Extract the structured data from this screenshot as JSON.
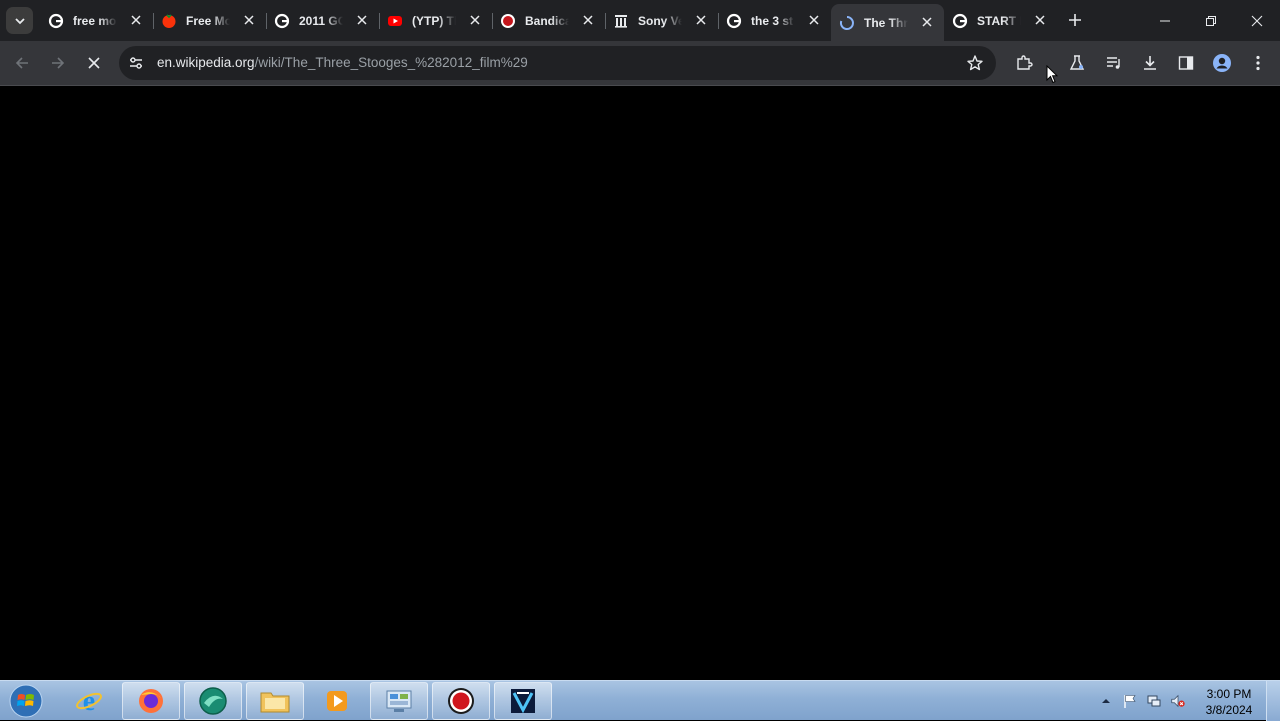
{
  "tabs": [
    {
      "title": "free mo",
      "icon": "google-icon"
    },
    {
      "title": "Free Mo",
      "icon": "tomato-icon"
    },
    {
      "title": "2011 GC",
      "icon": "google-icon"
    },
    {
      "title": "(YTP) Th",
      "icon": "youtube-icon"
    },
    {
      "title": "Bandica",
      "icon": "bandicam-icon"
    },
    {
      "title": "Sony Ve",
      "icon": "wikipedia-icon"
    },
    {
      "title": "the 3 st",
      "icon": "google-icon"
    },
    {
      "title": "The Thr",
      "icon": "loading-icon",
      "active": true
    },
    {
      "title": "START I",
      "icon": "google-icon"
    }
  ],
  "address_bar": {
    "host": "en.wikipedia.org",
    "path": "/wiki/The_Three_Stooges_%282012_film%29"
  },
  "taskbar": {
    "apps": [
      "internet-explorer-icon",
      "firefox-icon",
      "browser-icon",
      "file-explorer-icon",
      "media-player-icon",
      "control-panel-icon",
      "bandicam-icon",
      "video-editor-icon"
    ],
    "clock_time": "3:00 PM",
    "clock_date": "3/8/2024"
  },
  "colors": {
    "tabstrip_bg": "#202124",
    "toolbar_bg": "#35363a",
    "content_bg": "#000000",
    "accent_blue": "#8ab4f8"
  }
}
